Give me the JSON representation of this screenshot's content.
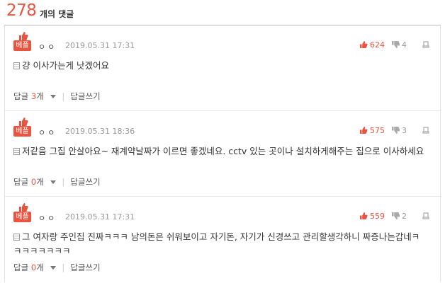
{
  "header": {
    "count": "278",
    "count_label": "개의 댓글"
  },
  "best_label": "베플",
  "reply_label": "답글",
  "reply_unit": "개",
  "write_label": "답글쓰기",
  "comments": [
    {
      "nick": "ㅇㅇ",
      "date": "2019.05.31 17:31",
      "up": "624",
      "down": "4",
      "text": "걍 이사가는게 낫겠어요",
      "reply_count": "3"
    },
    {
      "nick": "ㅇㅇ",
      "date": "2019.05.31 18:36",
      "up": "575",
      "down": "3",
      "text": "저같음 그집 안살아요~ 재계약날짜가 이르면 좋겠네요. cctv 있는 곳이나 설치하게해주는 집으로 이사하세요",
      "reply_count": "0"
    },
    {
      "nick": "ㅇㅇ",
      "date": "2019.05.31 17:31",
      "up": "559",
      "down": "2",
      "text": "그 여자랑 주인집 진짜ㅋㅋㅋ 남의돈은 쉬워보이고 자기돈, 자기가 신경쓰고 관리할생각하니 짜증나는갑네ㅋㅋㅋㅋㅋㅋㅋㅋ",
      "reply_count": "0"
    }
  ],
  "colors": {
    "accent": "#e8543f",
    "muted": "#999999"
  },
  "icons": [
    "thumbs-up-icon",
    "thumbs-down-icon",
    "report-icon",
    "document-icon",
    "chevron-down-icon"
  ]
}
